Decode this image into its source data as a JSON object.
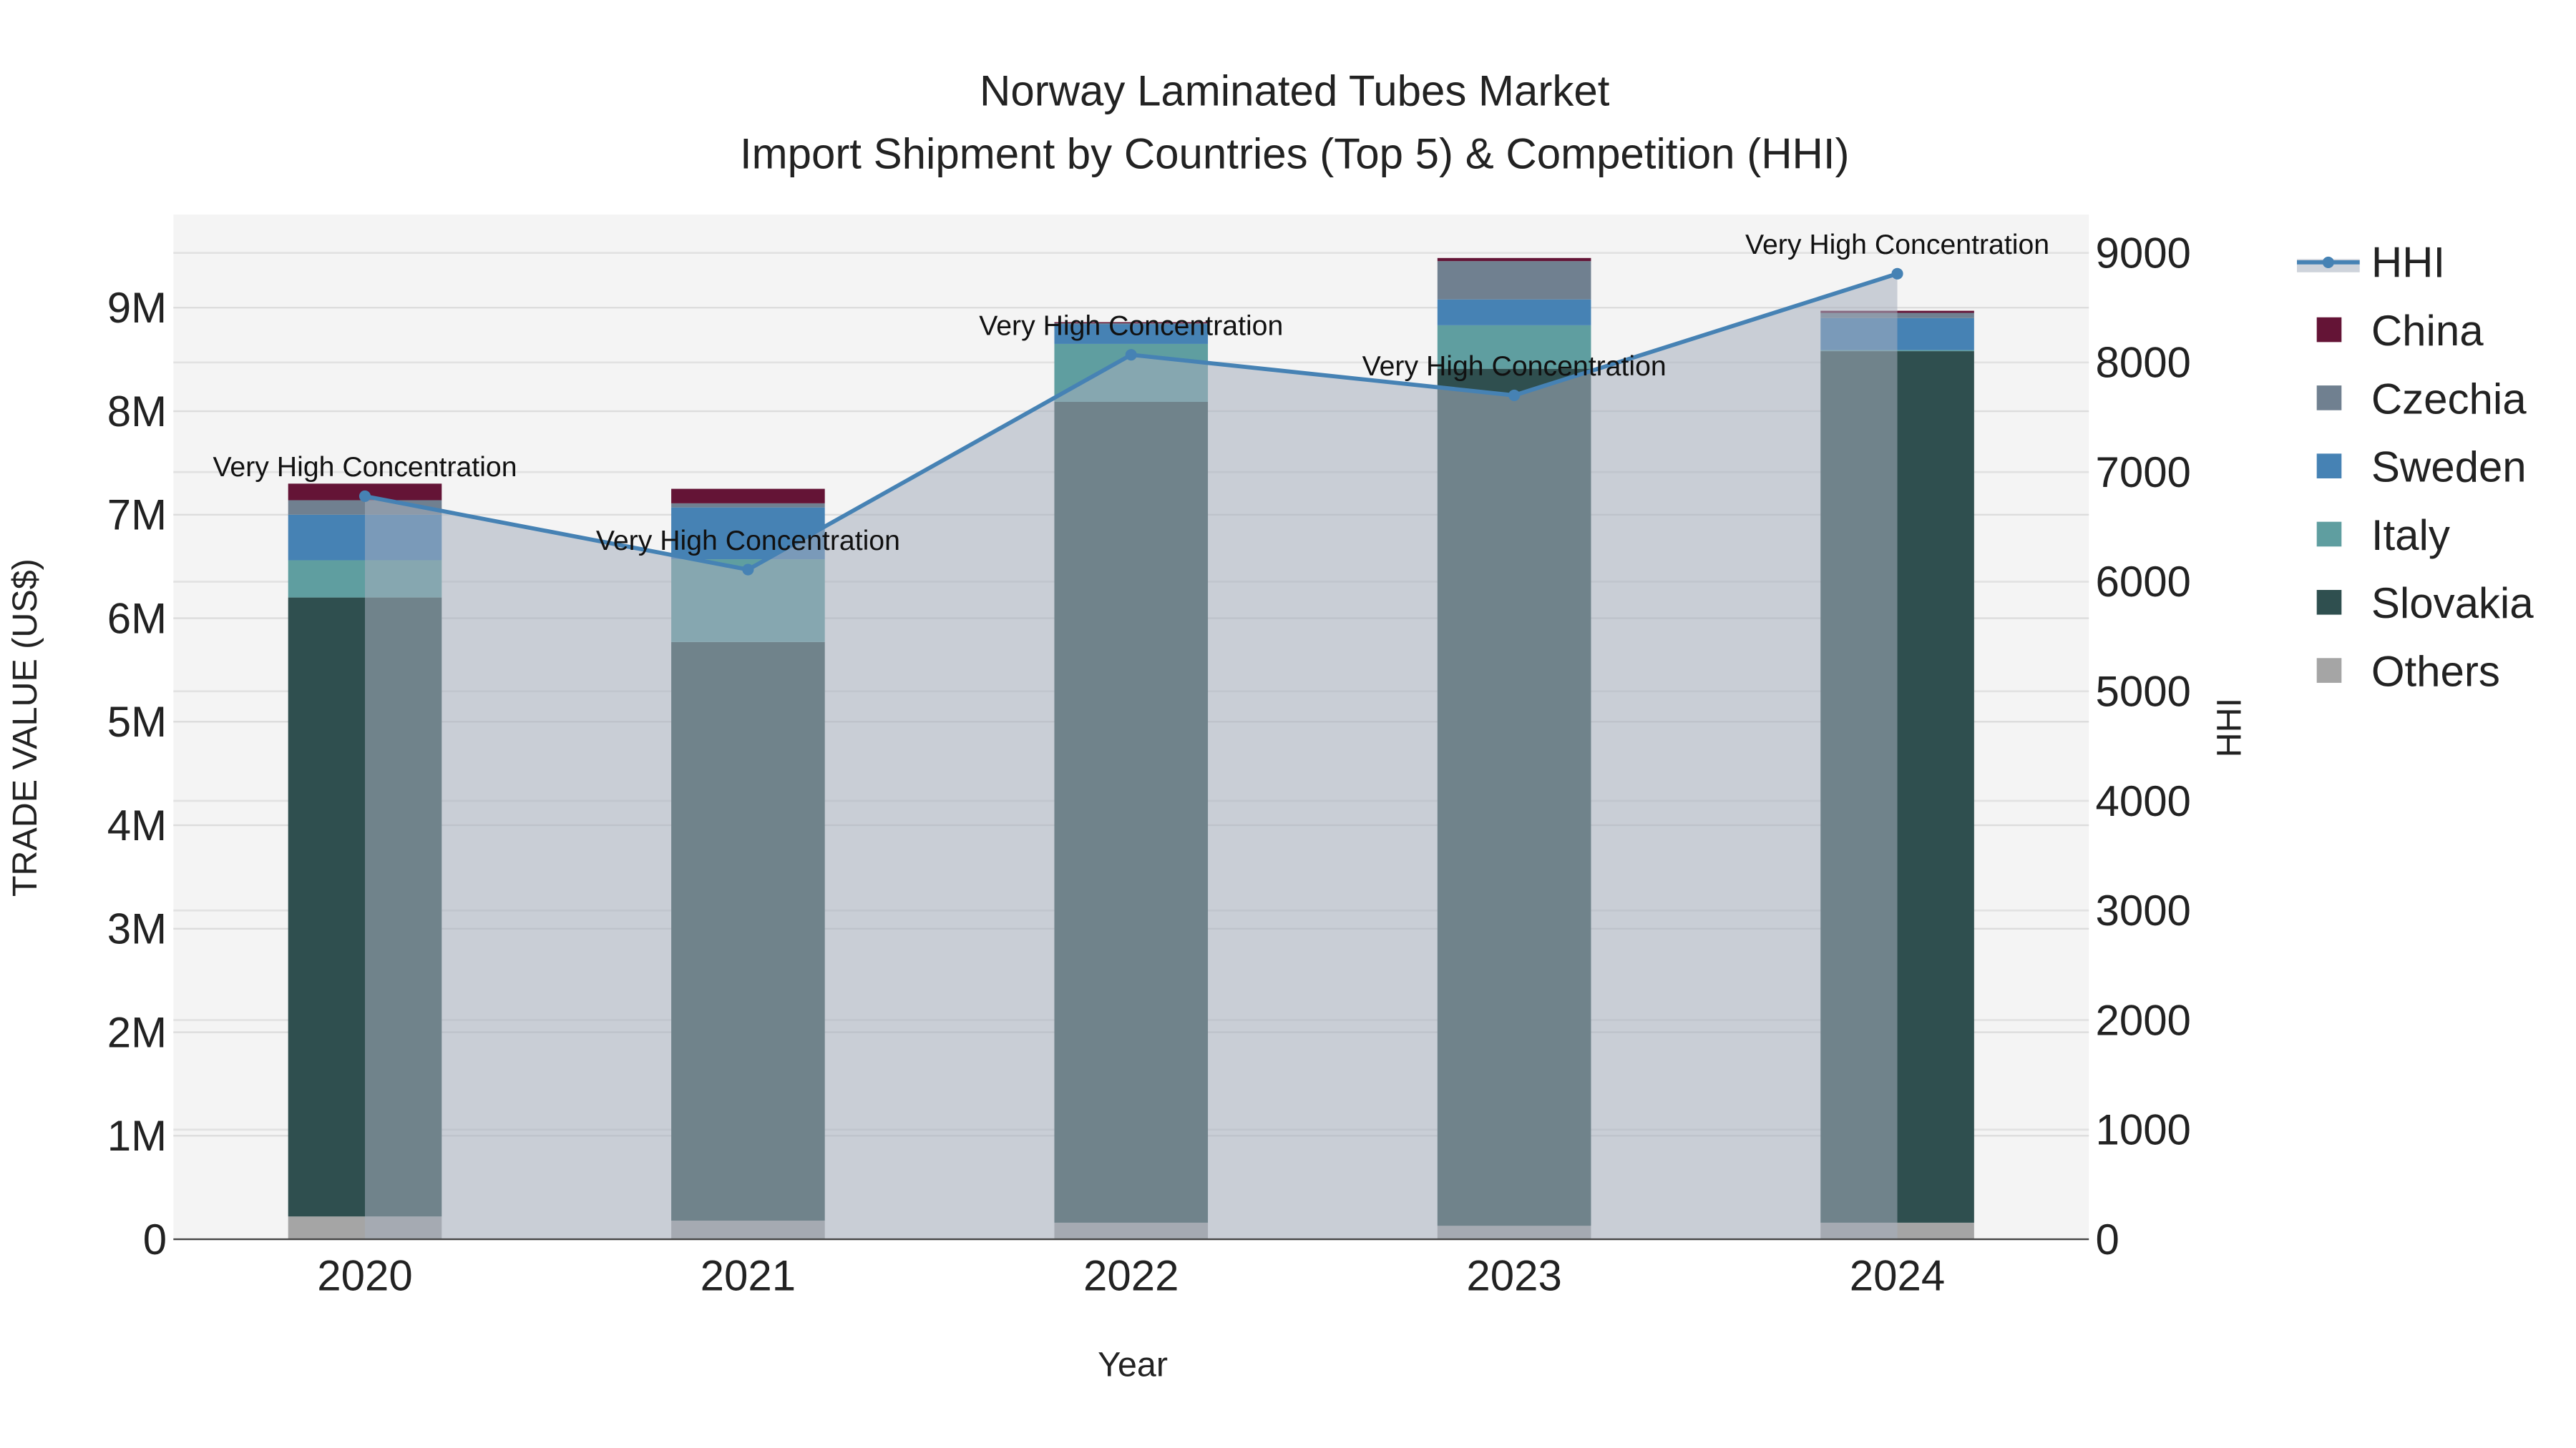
{
  "chart_data": {
    "type": "bar",
    "title": "Norway Laminated Tubes Market",
    "subtitle": "Import Shipment by Countries (Top 5) & Competition (HHI)",
    "xlabel": "Year",
    "ylabel": "TRADE VALUE (US$)",
    "y2label": "HHI",
    "categories": [
      "2020",
      "2021",
      "2022",
      "2023",
      "2024"
    ],
    "ylim": [
      0,
      9900000
    ],
    "y2lim": [
      0,
      9350
    ],
    "yticks": [
      0,
      1000000,
      2000000,
      3000000,
      4000000,
      5000000,
      6000000,
      7000000,
      8000000,
      9000000
    ],
    "ytick_labels": [
      "0",
      "1M",
      "2M",
      "3M",
      "4M",
      "5M",
      "6M",
      "7M",
      "8M",
      "9M"
    ],
    "y2ticks": [
      0,
      1000,
      2000,
      3000,
      4000,
      5000,
      6000,
      7000,
      8000,
      9000
    ],
    "y2tick_labels": [
      "0",
      "1000",
      "2000",
      "3000",
      "4000",
      "5000",
      "6000",
      "7000",
      "8000",
      "9000"
    ],
    "stacked": true,
    "series": [
      {
        "name": "Others",
        "color": "#a5a5a5",
        "values": [
          220000,
          180000,
          160000,
          130000,
          160000
        ]
      },
      {
        "name": "Slovakia",
        "color": "#2f4f4f",
        "values": [
          5980000,
          5590000,
          7930000,
          8280000,
          8420000
        ]
      },
      {
        "name": "Italy",
        "color": "#5f9ea0",
        "values": [
          360000,
          800000,
          560000,
          420000,
          10000
        ]
      },
      {
        "name": "Sweden",
        "color": "#4682b4",
        "values": [
          440000,
          500000,
          190000,
          250000,
          310000
        ]
      },
      {
        "name": "Czechia",
        "color": "#708090",
        "values": [
          140000,
          40000,
          10000,
          370000,
          50000
        ]
      },
      {
        "name": "China",
        "color": "#641436",
        "values": [
          160000,
          140000,
          10000,
          30000,
          20000
        ]
      }
    ],
    "hhi": {
      "name": "HHI",
      "color": "#4682b4",
      "values": [
        6780,
        6110,
        8070,
        7700,
        8810
      ],
      "annotations": [
        "Very High Concentration",
        "Very High Concentration",
        "Very High Concentration",
        "Very High Concentration",
        "Very High Concentration"
      ]
    },
    "legend_order": [
      "HHI",
      "China",
      "Czechia",
      "Sweden",
      "Italy",
      "Slovakia",
      "Others"
    ],
    "legend_placement": "right",
    "grid": true
  }
}
